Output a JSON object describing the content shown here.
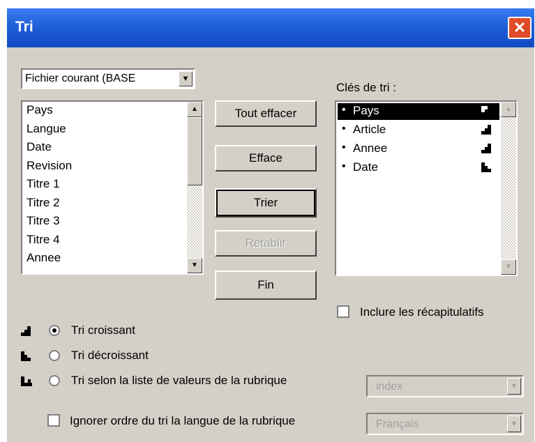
{
  "window": {
    "title": "Tri",
    "close_glyph": "✕"
  },
  "file_combo": {
    "value": "Fichier courant (BASE"
  },
  "fields_list": {
    "items": [
      "Pays",
      "Langue",
      "Date",
      "Revision",
      "Titre 1",
      "Titre 2",
      "Titre 3",
      "Titre 4",
      "Annee"
    ]
  },
  "buttons": {
    "clear_all": "Tout effacer",
    "clear": "Efface",
    "sort": "Trier",
    "restore": "Retablir",
    "end": "Fin"
  },
  "sort_keys": {
    "label": "Clés de tri :",
    "items": [
      {
        "label": "Pays",
        "order": "ascending",
        "selected": true
      },
      {
        "label": "Article",
        "order": "ascending",
        "selected": false
      },
      {
        "label": "Annee",
        "order": "ascending",
        "selected": false
      },
      {
        "label": "Date",
        "order": "descending",
        "selected": false
      }
    ]
  },
  "recap_checkbox": {
    "label": "Inclure les récapitulatifs",
    "checked": false
  },
  "sort_options": [
    {
      "label": "Tri croissant",
      "selected": true,
      "icon": "sort-ascending-icon"
    },
    {
      "label": "Tri décroissant",
      "selected": false,
      "icon": "sort-descending-icon"
    },
    {
      "label": "Tri selon la liste de valeurs de la rubrique",
      "selected": false,
      "icon": "sort-list-icon"
    }
  ],
  "value_list_combo": {
    "value": "index"
  },
  "ignore_checkbox": {
    "label": "Ignorer ordre du tri la langue de la rubrique",
    "checked": false
  },
  "language_combo": {
    "value": "Français"
  }
}
